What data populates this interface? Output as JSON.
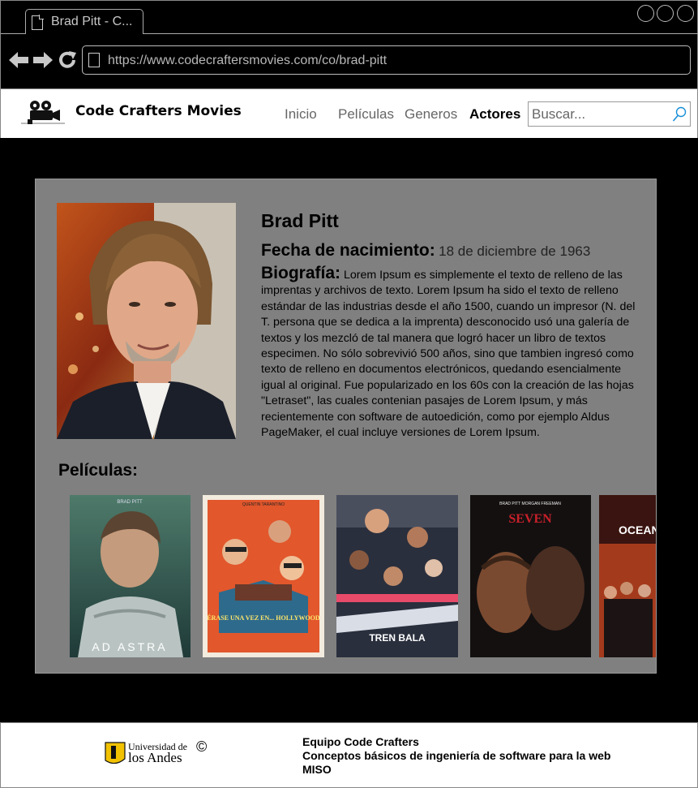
{
  "browser": {
    "tab_title": "Brad Pitt - C...",
    "url": "https://www.codecraftersmovies.com/co/brad-pitt"
  },
  "header": {
    "brand": "Code Crafters Movies",
    "nav": {
      "inicio": "Inicio",
      "peliculas": "Películas",
      "generos": "Generos",
      "actores": "Actores"
    },
    "search_placeholder": "Buscar..."
  },
  "actor": {
    "name": "Brad Pitt",
    "birth_label": "Fecha de nacimiento:",
    "birth_value": "18 de diciembre de 1963",
    "bio_label": "Biografía:",
    "bio_text": "Lorem Ipsum es simplemente el texto de relleno de las imprentas y archivos de texto. Lorem Ipsum ha sido el texto de relleno estándar de las industrias desde el año 1500, cuando un impresor (N. del T. persona que se dedica a la imprenta) desconocido usó una galería de textos y los mezcló de tal manera que logró hacer un libro de textos especimen. No sólo sobrevivió 500 años, sino que tambien ingresó como texto de relleno en documentos electrónicos, quedando esencialmente igual al original. Fue popularizado en los 60s con la creación de las hojas \"Letraset\", las cuales contenian pasajes de Lorem Ipsum, y más recientemente con software de autoedición, como por ejemplo Aldus PageMaker, el cual incluye versiones de Lorem Ipsum."
  },
  "movies": {
    "heading": "Películas:",
    "posters": [
      {
        "top_text": "BRAD PITT",
        "bottom_text": "AD ASTRA"
      },
      {
        "top_text": "QUENTIN TARANTINO",
        "bottom_text": "ÉRASE UNA VEZ EN... HOLLYWOOD"
      },
      {
        "top_text": "",
        "bottom_text": "TREN BALA"
      },
      {
        "top_text": "BRAD PITT    MORGAN FREEMAN",
        "bottom_text": "SEVEN"
      },
      {
        "top_text": "",
        "bottom_text": "OCEAN'S"
      }
    ]
  },
  "footer": {
    "uni_line1": "Universidad de",
    "uni_line2": "los Andes",
    "copyright": "©",
    "team": "Equipo Code Crafters",
    "course": "Conceptos básicos de ingeniería de software para la web",
    "program": "MISO"
  },
  "colors": {
    "page_bg": "#000000",
    "card_bg": "#808080",
    "header_bg": "#ffffff",
    "accent_red": "#c8202a",
    "uni_yellow": "#f2c200"
  }
}
